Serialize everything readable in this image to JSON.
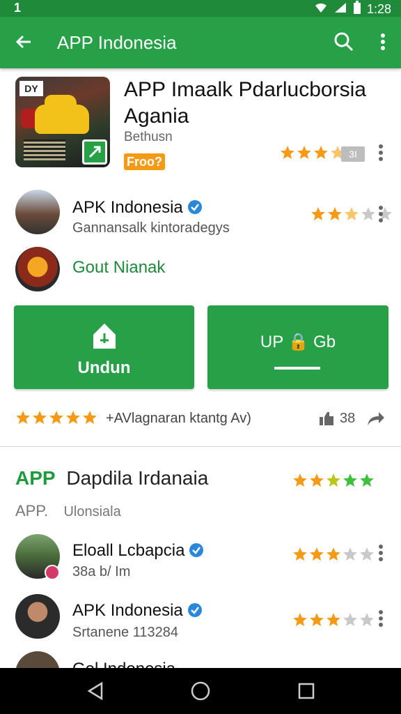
{
  "status": {
    "left": "1",
    "time": "1:28"
  },
  "appbar": {
    "title": "APP Indonesia"
  },
  "hero": {
    "title": "APP Imaalk Pdarlucborsia Agania",
    "subtitle": "Bethusn",
    "tag": "Froo?",
    "rating_stars": 3.5,
    "score_badge": "3I",
    "thumb_logo": "DY"
  },
  "rows": [
    {
      "title": "APK Indonesia",
      "subtitle": "Gannansalk kintoradegys",
      "stars": 2.5,
      "verified": true
    },
    {
      "title": "Gout Nianak"
    }
  ],
  "buttons": {
    "download_label": "Undun",
    "update_label": "UP 🔒 Gb"
  },
  "rating_bar": {
    "stars": 5,
    "text": "+AVlagnaran  ktantg Av)",
    "count": "38"
  },
  "section": {
    "title_green": "APP",
    "title_rest": "Dapdila Irdanaia",
    "sub_prefix": "APP.",
    "sub_text": "Ulonsiala",
    "stars": 5
  },
  "list": [
    {
      "title": "Eloall Lcbapcia",
      "subtitle": "38a b/ Im",
      "stars": 3
    },
    {
      "title": "APK Indonesia",
      "subtitle": "Srtanene 113284",
      "stars": 3
    },
    {
      "title": "Gel Indonesia"
    }
  ],
  "colors": {
    "primary": "#27a048",
    "status": "#1e8a3a",
    "star": "#f59a16"
  }
}
